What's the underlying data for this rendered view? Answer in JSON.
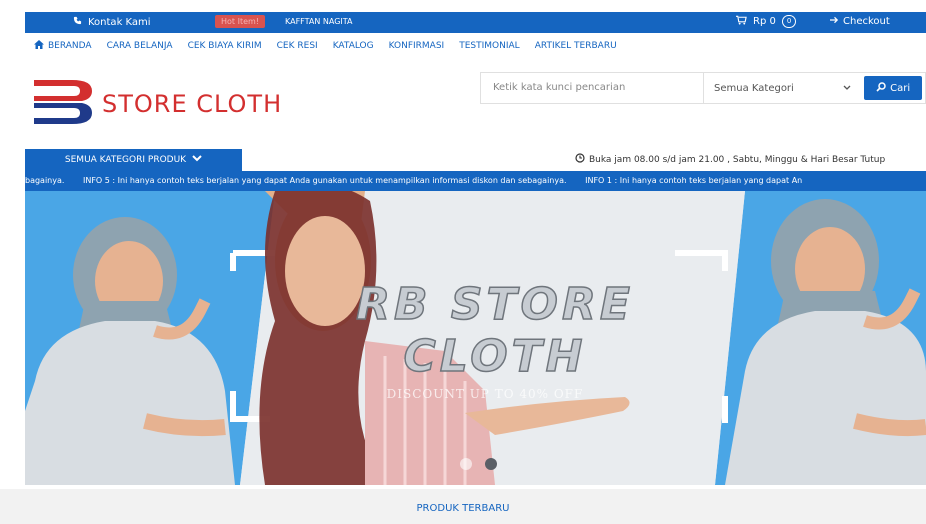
{
  "topbar": {
    "contact_label": "Kontak Kami",
    "hot_badge": "Hot Item!",
    "hot_product": "KAFFTAN NAGITA",
    "cart_total": "Rp 0",
    "cart_count": "0",
    "checkout_label": "Checkout"
  },
  "nav": {
    "items": [
      "BERANDA",
      "CARA BELANJA",
      "CEK BIAYA KIRIM",
      "CEK RESI",
      "KATALOG",
      "KONFIRMASI",
      "TESTIMONIAL",
      "ARTIKEL TERBARU"
    ]
  },
  "logo": {
    "text": "STORE CLOTH"
  },
  "search": {
    "placeholder": "Ketik kata kunci pencarian",
    "category_selected": "Semua Kategori",
    "button_label": "Cari"
  },
  "categories": {
    "button_label": "SEMUA KATEGORI PRODUK"
  },
  "hours": {
    "text": "Buka jam 08.00 s/d jam 21.00 , Sabtu, Minggu & Hari Besar Tutup"
  },
  "marquee": {
    "items": [
      "bagainya.",
      "INFO 5 : Ini hanya contoh teks berjalan yang dapat Anda gunakan untuk menampilkan informasi diskon dan sebagainya.",
      "INFO 1 : Ini hanya contoh teks berjalan yang dapat An"
    ]
  },
  "hero": {
    "title_line1": "RB STORE",
    "title_line2": "CLOTH",
    "subtitle": "DISCOUNT UP TO 40% OFF"
  },
  "section": {
    "title": "PRODUK TERBARU"
  },
  "colors": {
    "primary": "#1565c0",
    "logo_red": "#d32f2f",
    "hot_badge": "#d9534f"
  },
  "icons": [
    "phone-icon",
    "cart-icon",
    "arrow-right-icon",
    "home-icon",
    "chevron-down-icon",
    "search-icon",
    "clock-icon"
  ]
}
